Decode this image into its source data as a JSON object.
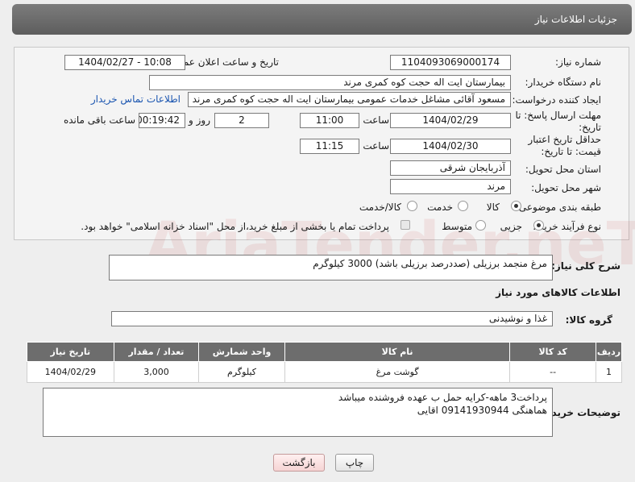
{
  "header": {
    "title": "جزئیات اطلاعات نیاز"
  },
  "form": {
    "need_number_label": "شماره نیاز:",
    "need_number": "1104093069000174",
    "announce_label": "تاریخ و ساعت اعلان عمومی:",
    "announce_value": "1404/02/27 - 10:08",
    "buyer_org_label": "نام دستگاه خریدار:",
    "buyer_org": "بیمارستان ایت اله حجت کوه کمری مرند",
    "creator_label": "ایجاد کننده درخواست:",
    "creator": "مسعود آقائی مشاغل خدمات عمومی بیمارستان ایت اله حجت کوه کمری مرند",
    "contact_link": "اطلاعات تماس خریدار",
    "deadline_label": "مهلت ارسال پاسخ: تا تاریخ:",
    "deadline_date": "1404/02/29",
    "time_label": "ساعت",
    "deadline_time": "11:00",
    "days_value": "2",
    "days_label": "روز و",
    "remaining_time": "00:19:42",
    "remaining_label": "ساعت باقی مانده",
    "validity_label": "حداقل تاریخ اعتبار قیمت: تا تاریخ:",
    "validity_date": "1404/02/30",
    "validity_time_label": "ساعت",
    "validity_time": "11:15",
    "province_label": "استان محل تحویل:",
    "province": "آذربایجان شرقی",
    "city_label": "شهر محل تحویل:",
    "city": "مرند",
    "category_label": "طبقه بندی موضوعی:",
    "category_options": [
      "کالا",
      "خدمت",
      "کالا/خدمت"
    ],
    "category_selected": "کالا",
    "process_label": "نوع فرآیند خرید :",
    "process_options": [
      "جزیی",
      "متوسط"
    ],
    "process_selected": "جزیی",
    "payment_note": "پرداخت تمام یا بخشی از مبلغ خرید،از محل \"اسناد خزانه اسلامی\" خواهد بود."
  },
  "description": {
    "label": "شرح کلی نیاز:",
    "value": "مرغ منجمد برزیلی (صددرصد برزیلی باشد) 3000 کیلوگرم"
  },
  "goods_section": {
    "title": "اطلاعات کالاهای مورد نیاز",
    "group_label": "گروه کالا:",
    "group_value": "غذا و نوشیدنی"
  },
  "table": {
    "headers": [
      "ردیف",
      "کد کالا",
      "نام کالا",
      "واحد شمارش",
      "تعداد / مقدار",
      "تاریخ نیاز"
    ],
    "rows": [
      {
        "row": "1",
        "code": "--",
        "name": "گوشت مرغ",
        "unit": "کیلوگرم",
        "qty": "3,000",
        "date": "1404/02/29"
      }
    ]
  },
  "buyer_notes": {
    "label": "توضیحات خریدار:",
    "line1": "پرداخت3 ماهه-کرایه حمل ب عهده فروشنده میباشد",
    "line2": "هماهنگی 09141930944 اقایی"
  },
  "buttons": {
    "print": "چاپ",
    "back": "بازگشت"
  },
  "watermark": "AriaTender.neT"
}
